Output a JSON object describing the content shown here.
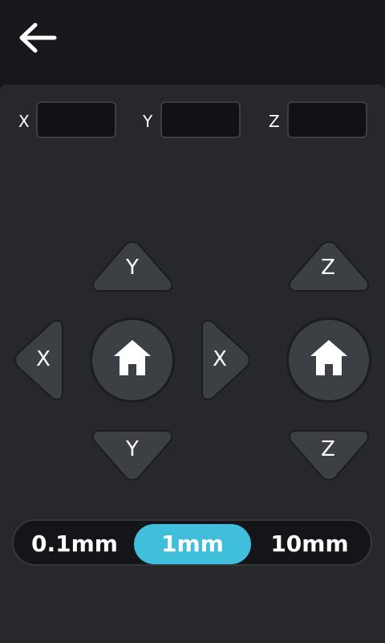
{
  "header": {
    "back_icon": "arrow-left-icon"
  },
  "coords": [
    {
      "axis": "X",
      "value": ""
    },
    {
      "axis": "Y",
      "value": ""
    },
    {
      "axis": "Z",
      "value": ""
    }
  ],
  "jog": {
    "y_up": "Y",
    "y_down": "Y",
    "x_left": "X",
    "x_right": "X",
    "z_up": "Z",
    "z_down": "Z",
    "home_icon": "home-icon"
  },
  "step": {
    "options": [
      "0.1mm",
      "1mm",
      "10mm"
    ],
    "selected": "1mm"
  },
  "colors": {
    "accent": "#3fbfdc",
    "panel": "#26282c",
    "button": "#3c3f44"
  }
}
